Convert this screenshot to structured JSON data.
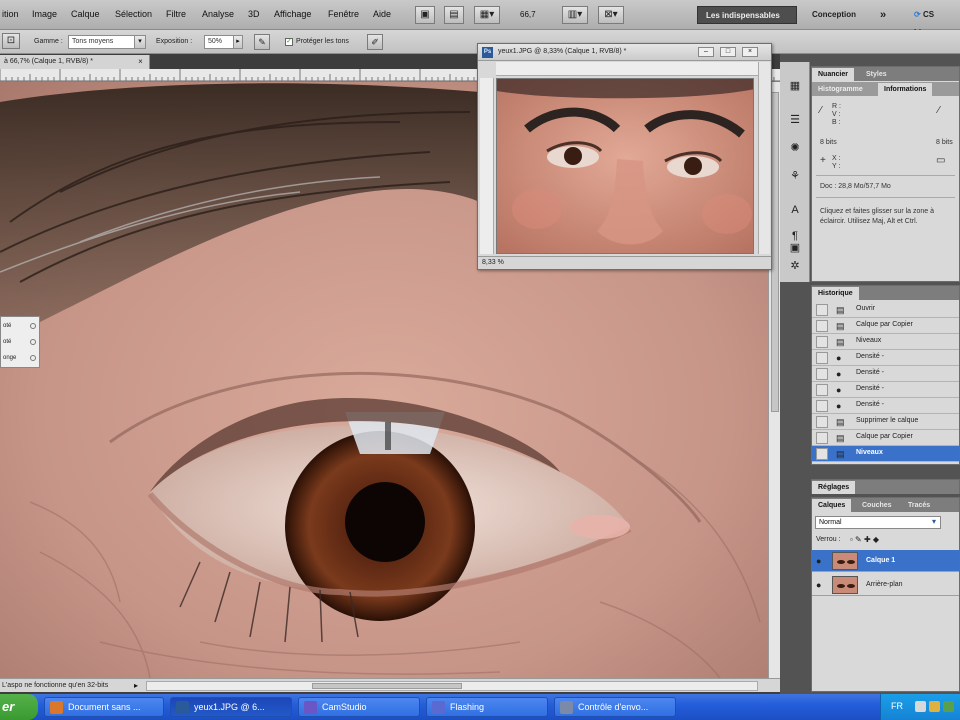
{
  "menubar": {
    "items": [
      "ition",
      "Image",
      "Calque",
      "Sélection",
      "Filtre",
      "Analyse",
      "3D",
      "Affichage",
      "Fenêtre",
      "Aide"
    ],
    "zoom_value": "66,7",
    "workspace_active": "Les indispensables",
    "workspace_other": "Conception",
    "workspace_more": "»",
    "cs_live": "CS Live"
  },
  "options": {
    "gamma_label": "Gamme :",
    "gamma_value": "Tons moyens",
    "exposure_label": "Exposition :",
    "exposure_value": "50%",
    "protect_label": "Protéger les tons"
  },
  "document": {
    "tab_title": "à 66,7% (Calque 1, RVB/8) *",
    "status_text": "L'aspo ne fonctionne qu'en 32-bits",
    "popup_rows": [
      "oté",
      "oté",
      "onge"
    ]
  },
  "float_window": {
    "title": "yeux1.JPG @ 8,33% (Calque 1, RVB/8) *",
    "zoom": "8,33 %"
  },
  "info_panel": {
    "tabs": [
      "Nuancier",
      "Styles"
    ],
    "subtabs": [
      "Histogramme",
      "Informations"
    ],
    "rgb_labels": [
      "R :",
      "V :",
      "B :"
    ],
    "xy_labels": [
      "X :",
      "Y :"
    ],
    "bits_left": "8 bits",
    "bits_right": "8 bits",
    "doc_size": "Doc : 28,8 Mo/57,7 Mo",
    "hint": "Cliquez et faites glisser sur la zone à éclaircir. Utilisez Maj, Alt et Ctrl."
  },
  "history": {
    "title": "Historique",
    "items": [
      {
        "label": "Ouvrir",
        "icon": "doc-icon"
      },
      {
        "label": "Calque par Copier",
        "icon": "doc-icon"
      },
      {
        "label": "Niveaux",
        "icon": "doc-icon"
      },
      {
        "label": "Densité -",
        "icon": "dodge-icon"
      },
      {
        "label": "Densité -",
        "icon": "dodge-icon"
      },
      {
        "label": "Densité -",
        "icon": "dodge-icon"
      },
      {
        "label": "Densité -",
        "icon": "dodge-icon"
      },
      {
        "label": "Supprimer le calque",
        "icon": "doc-icon"
      },
      {
        "label": "Calque par Copier",
        "icon": "doc-icon"
      },
      {
        "label": "Niveaux",
        "icon": "doc-icon",
        "selected": true
      }
    ]
  },
  "adjust": {
    "title": "Réglages"
  },
  "layers": {
    "tabs": [
      "Calques",
      "Couches",
      "Tracés"
    ],
    "blend": "Normal",
    "lock_label": "Verrou :",
    "items": [
      {
        "label": "Calque 1",
        "selected": true
      },
      {
        "label": "Arrière-plan",
        "selected": false
      }
    ]
  },
  "taskbar": {
    "start_label": "er",
    "buttons": [
      {
        "label": "Document sans ...",
        "icon_color": "#d9772b"
      },
      {
        "label": "yeux1.JPG @ 6...",
        "icon_color": "#2a5a9a",
        "active": true
      },
      {
        "label": "CamStudio",
        "icon_color": "#6a56c4"
      },
      {
        "label": "Flashing",
        "icon_color": "#5a6ad0"
      },
      {
        "label": "Contrôle d'envo...",
        "icon_color": "#7a8aa8"
      }
    ],
    "lang": "FR"
  },
  "colors": {
    "selection_blue": "#3b72c9",
    "taskbar_blue": "#245edb",
    "panel_grey": "#d9d9d9"
  }
}
